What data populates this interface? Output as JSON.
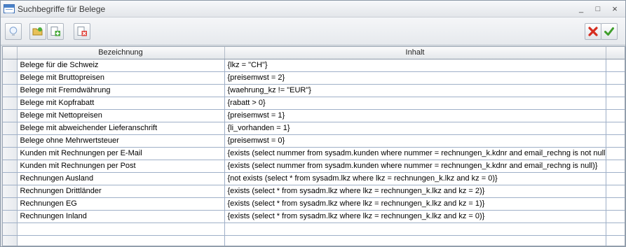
{
  "window": {
    "title": "Suchbegriffe für Belege"
  },
  "title_buttons": {
    "minimize": "_",
    "maximize": "□",
    "close": "×"
  },
  "toolbar": {
    "icons": [
      "lightbulb-icon",
      "folder-open-icon",
      "add-document-icon",
      "delete-document-icon",
      "cancel-icon",
      "confirm-icon"
    ]
  },
  "grid": {
    "columns": [
      "Bezeichnung",
      "Inhalt"
    ],
    "rows": [
      {
        "bezeichnung": "Belege für die Schweiz",
        "inhalt": "{lkz = \"CH\"}"
      },
      {
        "bezeichnung": "Belege mit Bruttopreisen",
        "inhalt": "{preisemwst = 2}"
      },
      {
        "bezeichnung": "Belege mit Fremdwährung",
        "inhalt": "{waehrung_kz != \"EUR\"}"
      },
      {
        "bezeichnung": "Belege mit Kopfrabatt",
        "inhalt": "{rabatt > 0}"
      },
      {
        "bezeichnung": "Belege mit Nettopreisen",
        "inhalt": "{preisemwst = 1}"
      },
      {
        "bezeichnung": "Belege mit abweichender Lieferanschrift",
        "inhalt": "{li_vorhanden = 1}"
      },
      {
        "bezeichnung": "Belege ohne Mehrwertsteuer",
        "inhalt": "{preisemwst = 0}"
      },
      {
        "bezeichnung": "Kunden mit Rechnungen per E-Mail",
        "inhalt": "{exists (select nummer from sysadm.kunden where nummer = rechnungen_k.kdnr and email_rechng is not null)}"
      },
      {
        "bezeichnung": "Kunden mit Rechnungen per Post",
        "inhalt": "{exists (select nummer from sysadm.kunden where nummer = rechnungen_k.kdnr and email_rechng is null)}"
      },
      {
        "bezeichnung": "Rechnungen Ausland",
        "inhalt": "{not exists (select * from sysadm.lkz where lkz = rechnungen_k.lkz and kz = 0)}"
      },
      {
        "bezeichnung": "Rechnungen Drittländer",
        "inhalt": "{exists (select * from sysadm.lkz where lkz = rechnungen_k.lkz and kz = 2)}"
      },
      {
        "bezeichnung": "Rechnungen EG",
        "inhalt": "{exists (select * from sysadm.lkz where lkz = rechnungen_k.lkz and kz = 1)}"
      },
      {
        "bezeichnung": "Rechnungen Inland",
        "inhalt": "{exists (select * from sysadm.lkz where lkz = rechnungen_k.lkz and kz = 0)}"
      },
      {
        "bezeichnung": "",
        "inhalt": ""
      },
      {
        "bezeichnung": "",
        "inhalt": ""
      }
    ]
  }
}
